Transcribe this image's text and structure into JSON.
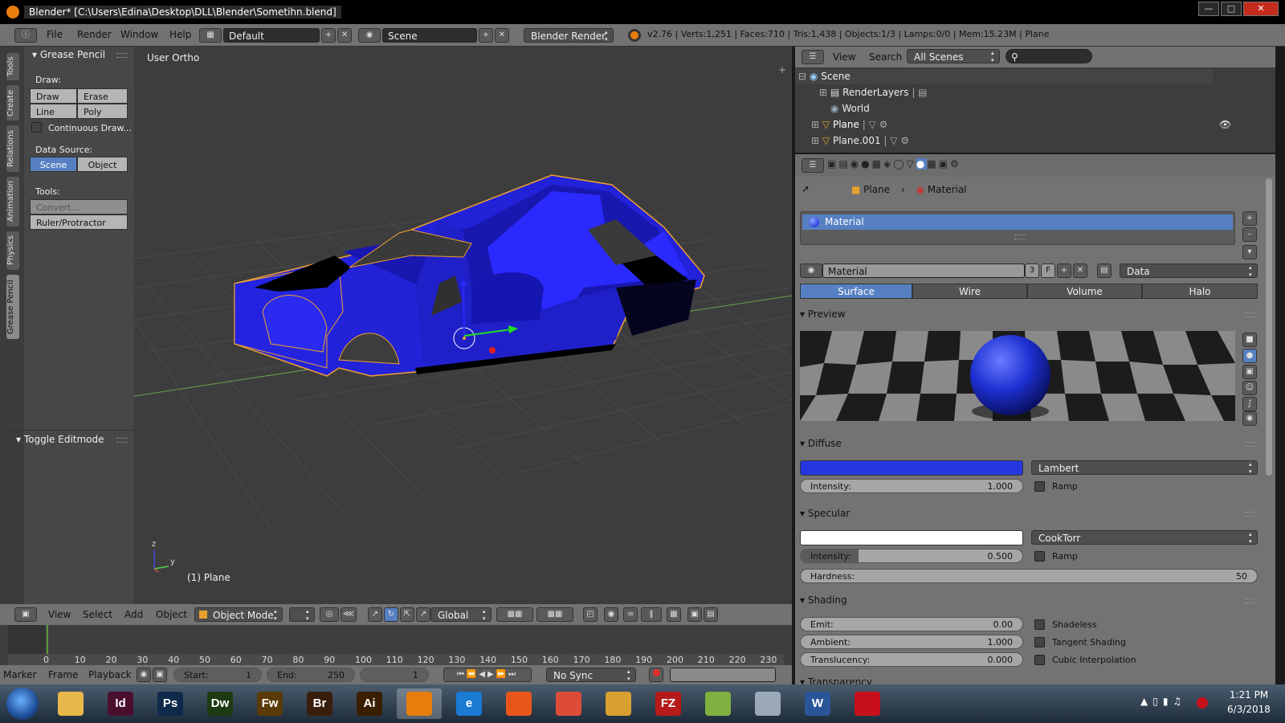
{
  "window": {
    "title": "Blender* [C:\\Users\\Edina\\Desktop\\DLL\\Blender\\Sometihn.blend]",
    "controls": [
      "—",
      "□",
      "✕"
    ]
  },
  "info_header": {
    "menus": [
      "File",
      "Render",
      "Window",
      "Help"
    ],
    "layout": "Default",
    "scene": "Scene",
    "engine": "Blender Render",
    "stats": "v2.76 | Verts:1,251 | Faces:710 | Tris:1,438 | Objects:1/3 | Lamps:0/0 | Mem:15.23M | Plane"
  },
  "toolshelf": {
    "tabs": [
      "Tools",
      "Create",
      "Relations",
      "Animation",
      "Physics",
      "Grease Pencil"
    ],
    "panel_title": "Grease Pencil",
    "draw_label": "Draw:",
    "draw": "Draw",
    "erase": "Erase",
    "line": "Line",
    "poly": "Poly",
    "continuous": "Continuous Draw...",
    "data_source_label": "Data Source:",
    "scene_btn": "Scene",
    "object_btn": "Object",
    "tools_label": "Tools:",
    "convert": "Convert...",
    "ruler": "Ruler/Protractor",
    "toggle_editmode": "Toggle Editmode"
  },
  "viewport": {
    "view_label": "User Ortho",
    "object_label": "(1) Plane",
    "axis_y": "y",
    "axis_z": "z",
    "colors": {
      "body": "#2020d8",
      "outline": "#f0a030",
      "bg": "#3d3d3d"
    }
  },
  "viewport_header": {
    "menus": [
      "View",
      "Select",
      "Add",
      "Object"
    ],
    "mode": "Object Mode",
    "orientation": "Global"
  },
  "timeline": {
    "ticks": [
      "0",
      "10",
      "20",
      "30",
      "40",
      "50",
      "60",
      "70",
      "80",
      "90",
      "100",
      "110",
      "120",
      "130",
      "140",
      "150",
      "160",
      "170",
      "180",
      "190",
      "200",
      "210",
      "220",
      "230"
    ],
    "menus": [
      "Marker",
      "Frame",
      "Playback"
    ],
    "start_label": "Start:",
    "start": "1",
    "end_label": "End:",
    "end": "250",
    "current": "1",
    "sync": "No Sync"
  },
  "outliner": {
    "menus": [
      "View",
      "Search"
    ],
    "scenes": "All Scenes",
    "tree": [
      "Scene",
      "RenderLayers",
      "World",
      "Plane",
      "Plane.001"
    ]
  },
  "properties": {
    "breadcrumb_obj": "Plane",
    "breadcrumb_mat": "Material",
    "slot": "Material",
    "material_name": "Material",
    "users": "3",
    "fake": "F",
    "link": "Data",
    "tabs": [
      "Surface",
      "Wire",
      "Volume",
      "Halo"
    ],
    "preview_title": "Preview",
    "diffuse": {
      "title": "Diffuse",
      "color": "#2538e0",
      "shader": "Lambert",
      "intensity_label": "Intensity:",
      "intensity": "1.000",
      "ramp": "Ramp"
    },
    "specular": {
      "title": "Specular",
      "color": "#ffffff",
      "shader": "CookTorr",
      "intensity_label": "Intensity:",
      "intensity": "0.500",
      "ramp": "Ramp",
      "hardness_label": "Hardness:",
      "hardness": "50",
      "intensity_fraction": 0.5
    },
    "shading": {
      "title": "Shading",
      "emit_label": "Emit:",
      "emit": "0.00",
      "ambient_label": "Ambient:",
      "ambient": "1.000",
      "translucency_label": "Translucency:",
      "translucency": "0.000",
      "shadeless": "Shadeless",
      "tangent": "Tangent Shading",
      "cubic": "Cubic Interpolation"
    },
    "transparency": "Transparency"
  },
  "taskbar": {
    "apps": [
      {
        "name": "Explorer",
        "label": "",
        "color": "#e8b84a"
      },
      {
        "name": "InDesign",
        "label": "Id",
        "color": "#4b0e2e"
      },
      {
        "name": "Photoshop",
        "label": "Ps",
        "color": "#0f2a4a"
      },
      {
        "name": "Dreamweaver",
        "label": "Dw",
        "color": "#1d3a12"
      },
      {
        "name": "Fireworks",
        "label": "Fw",
        "color": "#5a3a06"
      },
      {
        "name": "Bridge",
        "label": "Br",
        "color": "#3a1e0c"
      },
      {
        "name": "Illustrator",
        "label": "Ai",
        "color": "#3a1e00"
      },
      {
        "name": "Blender",
        "label": "",
        "color": "#e87d0d"
      },
      {
        "name": "Internet Explorer",
        "label": "e",
        "color": "#1a7ad4"
      },
      {
        "name": "Firefox",
        "label": "",
        "color": "#e8561a"
      },
      {
        "name": "Chrome",
        "label": "",
        "color": "#dd4b39"
      },
      {
        "name": "Photos",
        "label": "",
        "color": "#d8a030"
      },
      {
        "name": "FileZilla",
        "label": "FZ",
        "color": "#b51a1a"
      },
      {
        "name": "Notepad++",
        "label": "",
        "color": "#80b040"
      },
      {
        "name": "Calculator",
        "label": "",
        "color": "#9aa8b8"
      },
      {
        "name": "Word",
        "label": "W",
        "color": "#2a5699"
      },
      {
        "name": "Acrobat",
        "label": "",
        "color": "#c8101a"
      }
    ],
    "time": "1:21 PM",
    "date": "6/3/2018"
  }
}
